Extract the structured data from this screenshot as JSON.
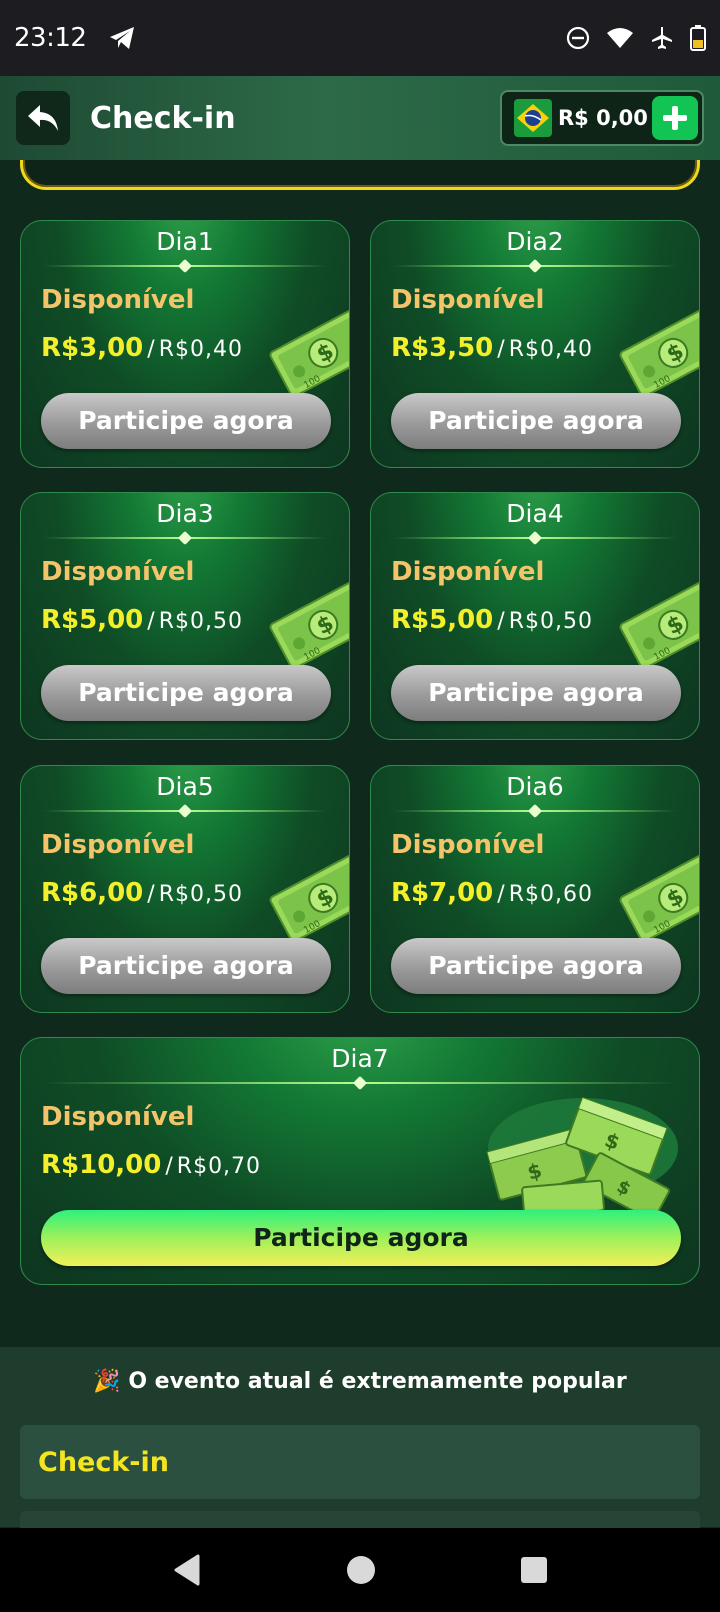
{
  "status_bar": {
    "time": "23:12",
    "icons": [
      "telegram-icon",
      "do-not-disturb-icon",
      "wifi-icon",
      "airplane-icon",
      "battery-icon"
    ]
  },
  "header": {
    "title": "Check-in",
    "wallet_amount": "R$ 0,00",
    "icons": [
      "back-icon",
      "brazil-flag-icon",
      "plus-icon"
    ]
  },
  "days": [
    {
      "title": "Dia1",
      "status": "Disponível",
      "reward": "R$3,00",
      "cost": "R$0,40",
      "button": "Participe agora"
    },
    {
      "title": "Dia2",
      "status": "Disponível",
      "reward": "R$3,50",
      "cost": "R$0,40",
      "button": "Participe agora"
    },
    {
      "title": "Dia3",
      "status": "Disponível",
      "reward": "R$5,00",
      "cost": "R$0,50",
      "button": "Participe agora"
    },
    {
      "title": "Dia4",
      "status": "Disponível",
      "reward": "R$5,00",
      "cost": "R$0,50",
      "button": "Participe agora"
    },
    {
      "title": "Dia5",
      "status": "Disponível",
      "reward": "R$6,00",
      "cost": "R$0,50",
      "button": "Participe agora"
    },
    {
      "title": "Dia6",
      "status": "Disponível",
      "reward": "R$7,00",
      "cost": "R$0,60",
      "button": "Participe agora"
    },
    {
      "title": "Dia7",
      "status": "Disponível",
      "reward": "R$10,00",
      "cost": "R$0,70",
      "button": "Participe agora"
    }
  ],
  "separator": "/",
  "popular": {
    "emoji": "🎉",
    "text": "O evento atual é extremamente popular"
  },
  "tabs": {
    "checkin": "Check-in"
  },
  "nav_icons": [
    "back-triangle-icon",
    "home-circle-icon",
    "recents-square-icon"
  ],
  "colors": {
    "accent_yellow": "#f3ef2b",
    "status_orange": "#f4c46a",
    "card_green": "#137a35",
    "plus_green": "#12c454"
  }
}
